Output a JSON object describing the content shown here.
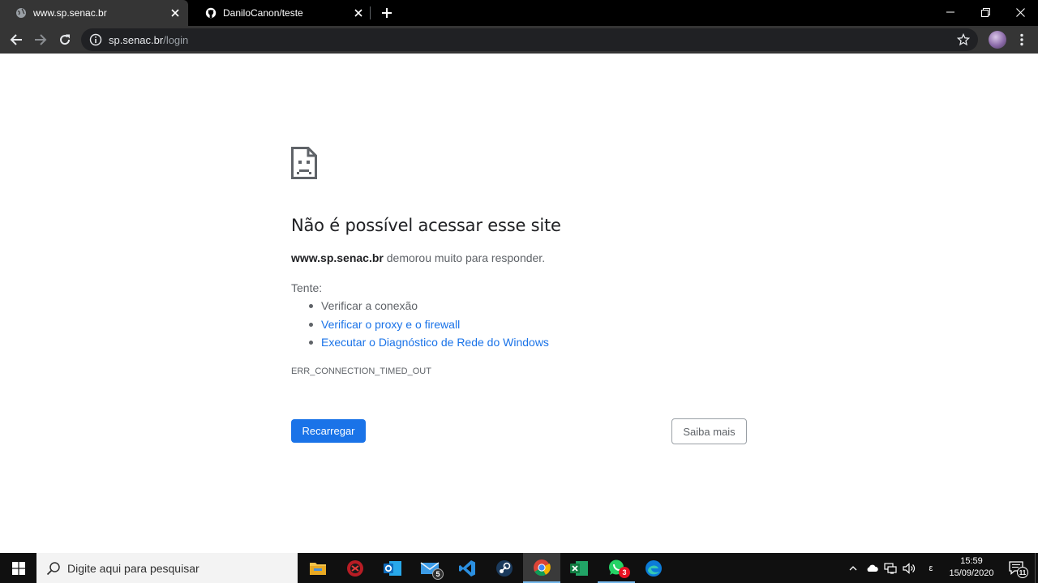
{
  "browser": {
    "tabs": [
      {
        "title": "www.sp.senac.br",
        "active": true,
        "favicon": "globe-icon"
      },
      {
        "title": "DaniloCanon/teste",
        "active": false,
        "favicon": "github-icon"
      }
    ],
    "address": {
      "host": "sp.senac.br",
      "path": "/login"
    }
  },
  "page": {
    "headline": "Não é possível acessar esse site",
    "summary_host": "www.sp.senac.br",
    "summary_text": " demorou muito para responder.",
    "try_label": "Tente:",
    "suggestions": [
      {
        "text": "Verificar a conexão",
        "link": false
      },
      {
        "text": "Verificar o proxy e o firewall",
        "link": true
      },
      {
        "text": "Executar o Diagnóstico de Rede do Windows",
        "link": true
      }
    ],
    "error_code": "ERR_CONNECTION_TIMED_OUT",
    "reload_label": "Recarregar",
    "learn_more_label": "Saiba mais"
  },
  "taskbar": {
    "search_placeholder": "Digite aqui para pesquisar",
    "apps": [
      {
        "name": "file-explorer",
        "badge": ""
      },
      {
        "name": "app-red",
        "badge": ""
      },
      {
        "name": "outlook",
        "badge": ""
      },
      {
        "name": "mail",
        "badge": "5"
      },
      {
        "name": "vscode",
        "badge": ""
      },
      {
        "name": "steam",
        "badge": ""
      },
      {
        "name": "chrome",
        "badge": ""
      },
      {
        "name": "excel",
        "badge": ""
      },
      {
        "name": "whatsapp",
        "badge": "3"
      },
      {
        "name": "edge",
        "badge": ""
      }
    ],
    "ime_label": "ε",
    "time": "15:59",
    "date": "15/09/2020",
    "notification_count": "11"
  },
  "colors": {
    "accent_blue": "#1a73e8",
    "tab_active_bg": "#353535",
    "tabstrip_bg": "#000000",
    "taskbar_bg": "#101010"
  }
}
